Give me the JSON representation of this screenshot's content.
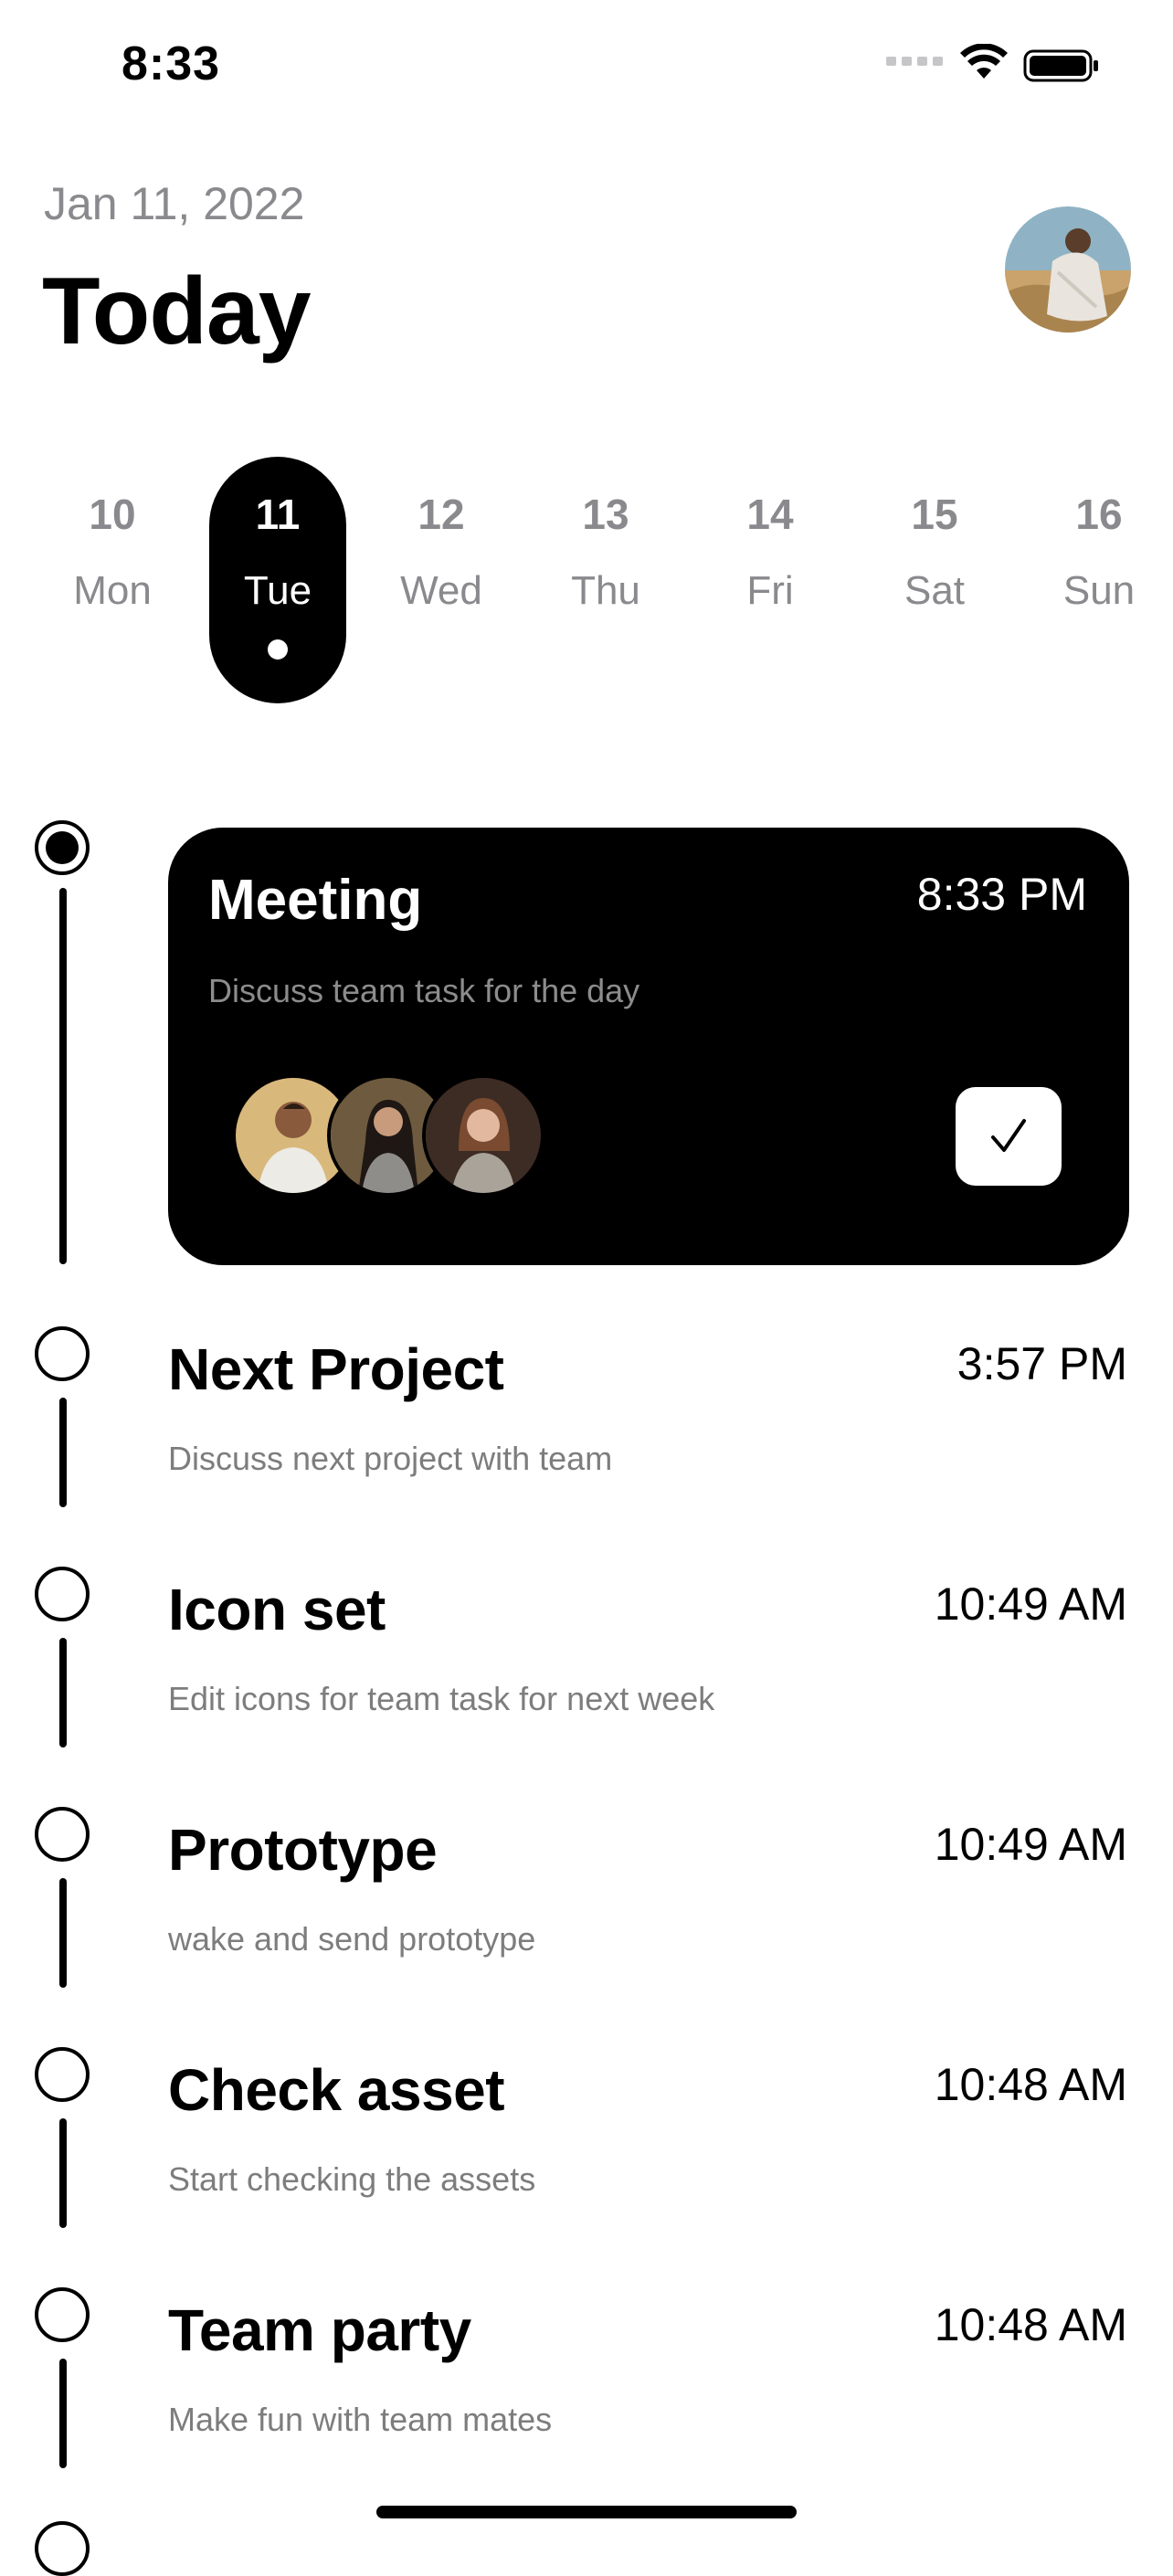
{
  "status_bar": {
    "time": "8:33"
  },
  "header": {
    "date": "Jan 11, 2022",
    "title": "Today"
  },
  "week": [
    {
      "num": "10",
      "day": "Mon",
      "selected": false
    },
    {
      "num": "11",
      "day": "Tue",
      "selected": true
    },
    {
      "num": "12",
      "day": "Wed",
      "selected": false
    },
    {
      "num": "13",
      "day": "Thu",
      "selected": false
    },
    {
      "num": "14",
      "day": "Fri",
      "selected": false
    },
    {
      "num": "15",
      "day": "Sat",
      "selected": false
    },
    {
      "num": "16",
      "day": "Sun",
      "selected": false
    }
  ],
  "featured_task": {
    "title": "Meeting",
    "time": "8:33 PM",
    "description": "Discuss team task for the day",
    "member_count": 3
  },
  "tasks": [
    {
      "title": "Next Project",
      "time": "3:57 PM",
      "description": "Discuss next project with team"
    },
    {
      "title": "Icon set",
      "time": "10:49 AM",
      "description": "Edit icons for team task for next week"
    },
    {
      "title": "Prototype",
      "time": "10:49 AM",
      "description": "wake and send prototype"
    },
    {
      "title": "Check asset",
      "time": "10:48 AM",
      "description": "Start checking the assets"
    },
    {
      "title": "Team party",
      "time": "10:48 AM",
      "description": "Make fun with team mates"
    }
  ],
  "colors": {
    "accent": "#000000",
    "muted": "#8a8a8e",
    "background": "#ffffff"
  }
}
